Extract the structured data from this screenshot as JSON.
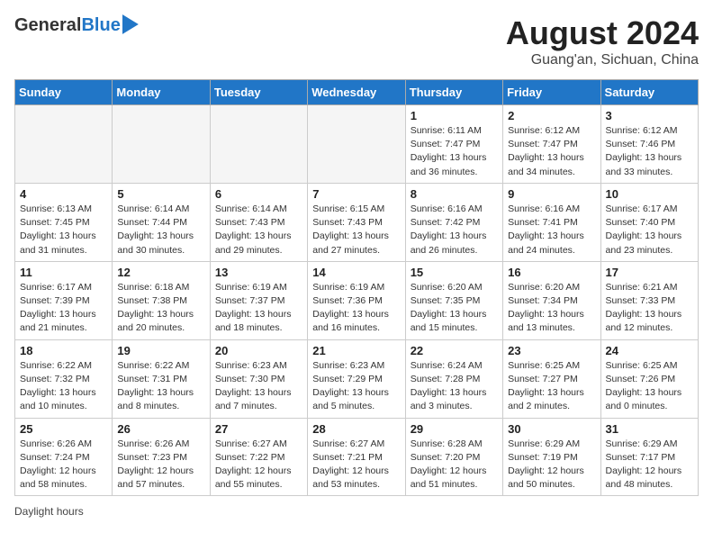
{
  "header": {
    "logo_line1": "General",
    "logo_line2": "Blue",
    "title": "August 2024",
    "subtitle": "Guang'an, Sichuan, China"
  },
  "calendar": {
    "headers": [
      "Sunday",
      "Monday",
      "Tuesday",
      "Wednesday",
      "Thursday",
      "Friday",
      "Saturday"
    ],
    "footer": "Daylight hours",
    "weeks": [
      [
        {
          "day": "",
          "info": ""
        },
        {
          "day": "",
          "info": ""
        },
        {
          "day": "",
          "info": ""
        },
        {
          "day": "",
          "info": ""
        },
        {
          "day": "1",
          "info": "Sunrise: 6:11 AM\nSunset: 7:47 PM\nDaylight: 13 hours\nand 36 minutes."
        },
        {
          "day": "2",
          "info": "Sunrise: 6:12 AM\nSunset: 7:47 PM\nDaylight: 13 hours\nand 34 minutes."
        },
        {
          "day": "3",
          "info": "Sunrise: 6:12 AM\nSunset: 7:46 PM\nDaylight: 13 hours\nand 33 minutes."
        }
      ],
      [
        {
          "day": "4",
          "info": "Sunrise: 6:13 AM\nSunset: 7:45 PM\nDaylight: 13 hours\nand 31 minutes."
        },
        {
          "day": "5",
          "info": "Sunrise: 6:14 AM\nSunset: 7:44 PM\nDaylight: 13 hours\nand 30 minutes."
        },
        {
          "day": "6",
          "info": "Sunrise: 6:14 AM\nSunset: 7:43 PM\nDaylight: 13 hours\nand 29 minutes."
        },
        {
          "day": "7",
          "info": "Sunrise: 6:15 AM\nSunset: 7:43 PM\nDaylight: 13 hours\nand 27 minutes."
        },
        {
          "day": "8",
          "info": "Sunrise: 6:16 AM\nSunset: 7:42 PM\nDaylight: 13 hours\nand 26 minutes."
        },
        {
          "day": "9",
          "info": "Sunrise: 6:16 AM\nSunset: 7:41 PM\nDaylight: 13 hours\nand 24 minutes."
        },
        {
          "day": "10",
          "info": "Sunrise: 6:17 AM\nSunset: 7:40 PM\nDaylight: 13 hours\nand 23 minutes."
        }
      ],
      [
        {
          "day": "11",
          "info": "Sunrise: 6:17 AM\nSunset: 7:39 PM\nDaylight: 13 hours\nand 21 minutes."
        },
        {
          "day": "12",
          "info": "Sunrise: 6:18 AM\nSunset: 7:38 PM\nDaylight: 13 hours\nand 20 minutes."
        },
        {
          "day": "13",
          "info": "Sunrise: 6:19 AM\nSunset: 7:37 PM\nDaylight: 13 hours\nand 18 minutes."
        },
        {
          "day": "14",
          "info": "Sunrise: 6:19 AM\nSunset: 7:36 PM\nDaylight: 13 hours\nand 16 minutes."
        },
        {
          "day": "15",
          "info": "Sunrise: 6:20 AM\nSunset: 7:35 PM\nDaylight: 13 hours\nand 15 minutes."
        },
        {
          "day": "16",
          "info": "Sunrise: 6:20 AM\nSunset: 7:34 PM\nDaylight: 13 hours\nand 13 minutes."
        },
        {
          "day": "17",
          "info": "Sunrise: 6:21 AM\nSunset: 7:33 PM\nDaylight: 13 hours\nand 12 minutes."
        }
      ],
      [
        {
          "day": "18",
          "info": "Sunrise: 6:22 AM\nSunset: 7:32 PM\nDaylight: 13 hours\nand 10 minutes."
        },
        {
          "day": "19",
          "info": "Sunrise: 6:22 AM\nSunset: 7:31 PM\nDaylight: 13 hours\nand 8 minutes."
        },
        {
          "day": "20",
          "info": "Sunrise: 6:23 AM\nSunset: 7:30 PM\nDaylight: 13 hours\nand 7 minutes."
        },
        {
          "day": "21",
          "info": "Sunrise: 6:23 AM\nSunset: 7:29 PM\nDaylight: 13 hours\nand 5 minutes."
        },
        {
          "day": "22",
          "info": "Sunrise: 6:24 AM\nSunset: 7:28 PM\nDaylight: 13 hours\nand 3 minutes."
        },
        {
          "day": "23",
          "info": "Sunrise: 6:25 AM\nSunset: 7:27 PM\nDaylight: 13 hours\nand 2 minutes."
        },
        {
          "day": "24",
          "info": "Sunrise: 6:25 AM\nSunset: 7:26 PM\nDaylight: 13 hours\nand 0 minutes."
        }
      ],
      [
        {
          "day": "25",
          "info": "Sunrise: 6:26 AM\nSunset: 7:24 PM\nDaylight: 12 hours\nand 58 minutes."
        },
        {
          "day": "26",
          "info": "Sunrise: 6:26 AM\nSunset: 7:23 PM\nDaylight: 12 hours\nand 57 minutes."
        },
        {
          "day": "27",
          "info": "Sunrise: 6:27 AM\nSunset: 7:22 PM\nDaylight: 12 hours\nand 55 minutes."
        },
        {
          "day": "28",
          "info": "Sunrise: 6:27 AM\nSunset: 7:21 PM\nDaylight: 12 hours\nand 53 minutes."
        },
        {
          "day": "29",
          "info": "Sunrise: 6:28 AM\nSunset: 7:20 PM\nDaylight: 12 hours\nand 51 minutes."
        },
        {
          "day": "30",
          "info": "Sunrise: 6:29 AM\nSunset: 7:19 PM\nDaylight: 12 hours\nand 50 minutes."
        },
        {
          "day": "31",
          "info": "Sunrise: 6:29 AM\nSunset: 7:17 PM\nDaylight: 12 hours\nand 48 minutes."
        }
      ]
    ]
  }
}
